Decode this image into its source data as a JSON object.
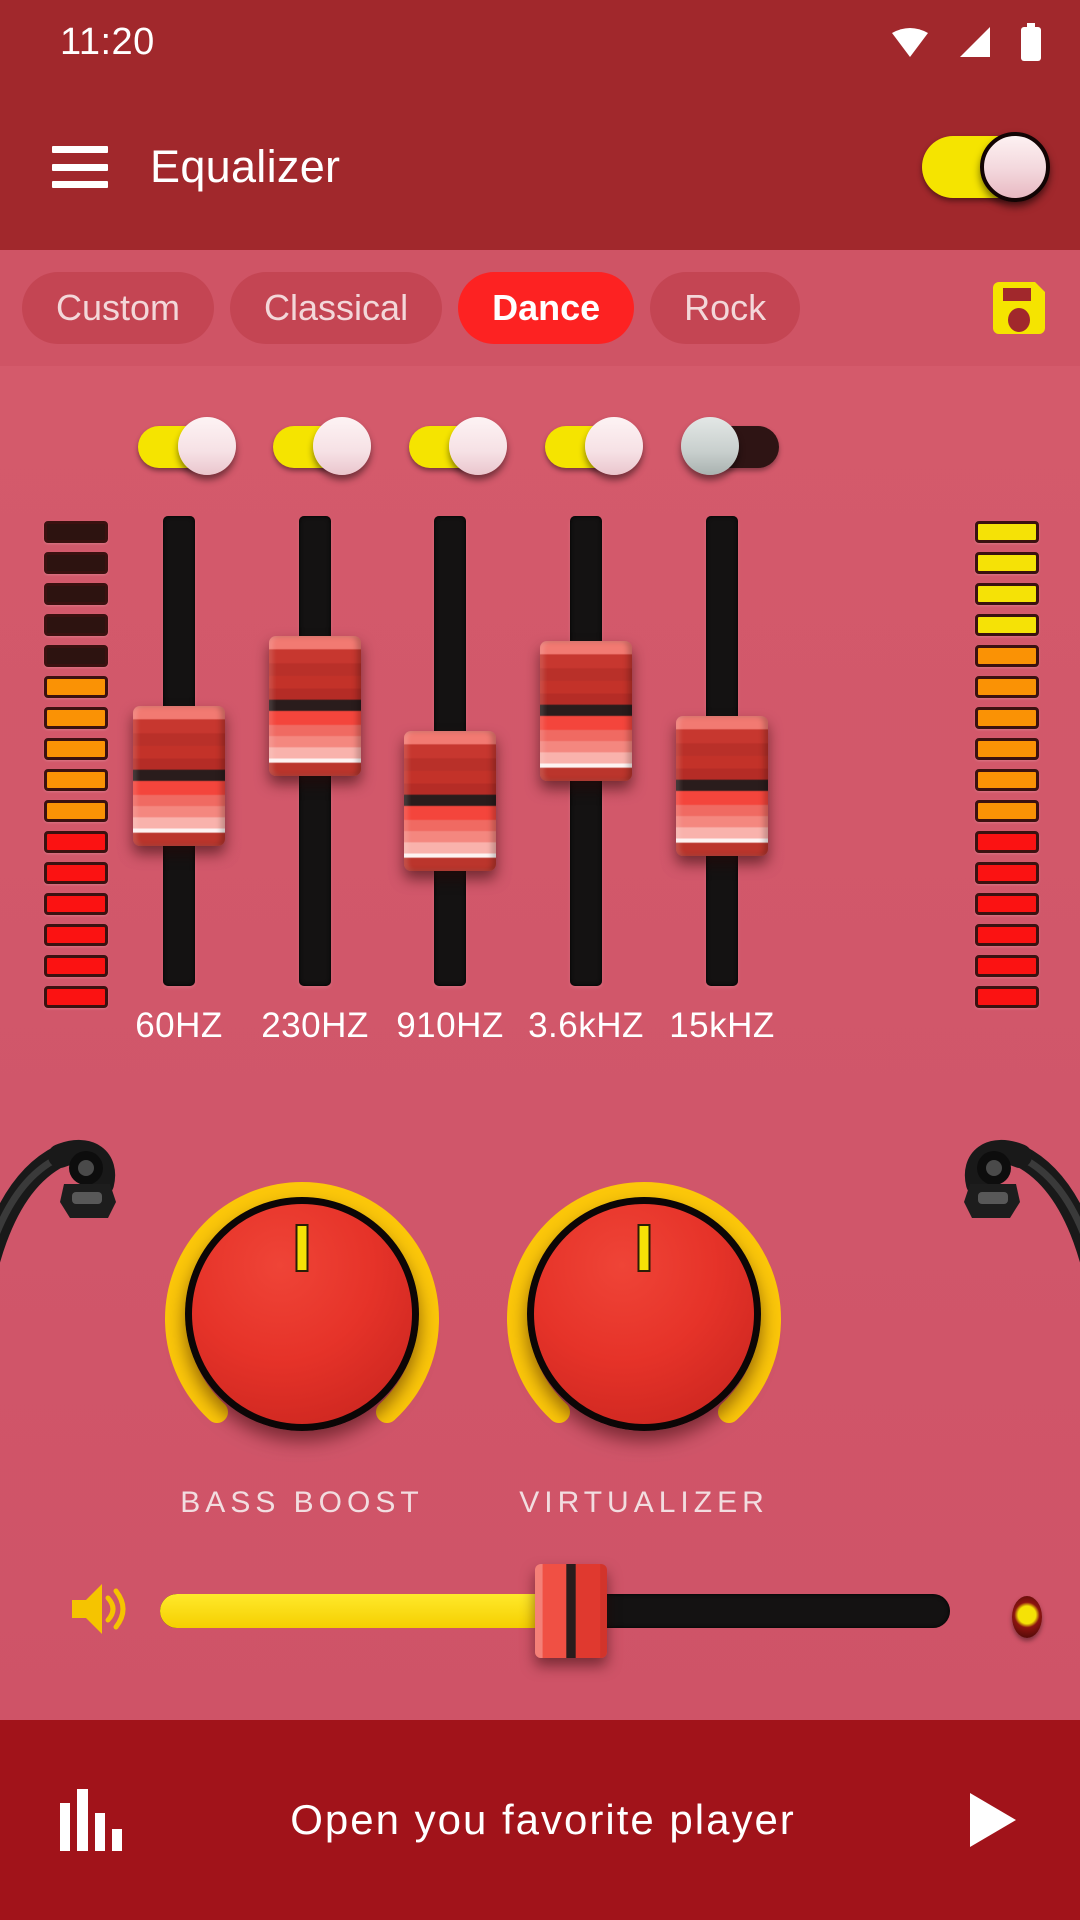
{
  "status_bar": {
    "time": "11:20",
    "icons": [
      "wifi-icon",
      "signal-icon",
      "battery-icon"
    ]
  },
  "app_bar": {
    "menu_icon": "hamburger-menu-icon",
    "title": "Equalizer",
    "master_switch": {
      "state": "on",
      "track_color": "#f5e400"
    }
  },
  "presets": {
    "items": [
      {
        "label": "Custom",
        "active": false
      },
      {
        "label": "Classical",
        "active": false
      },
      {
        "label": "Dance",
        "active": true
      },
      {
        "label": "Rock",
        "active": false
      }
    ],
    "save_icon": "floppy-save-icon",
    "active_color": "#fd2222",
    "save_color": "#f5e400"
  },
  "equalizer": {
    "bands": [
      {
        "label": "60HZ",
        "toggle": "on",
        "value": 44
      },
      {
        "label": "230HZ",
        "toggle": "on",
        "value": 63
      },
      {
        "label": "910HZ",
        "toggle": "on",
        "value": 36
      },
      {
        "label": "3.6kHZ",
        "toggle": "on",
        "value": 62
      },
      {
        "label": "15kHZ",
        "toggle": "off",
        "value": 41
      }
    ],
    "meter_left": [
      "off",
      "off",
      "off",
      "off",
      "off",
      "o",
      "o",
      "o",
      "o",
      "o",
      "r",
      "r",
      "r",
      "r",
      "r",
      "r"
    ],
    "meter_right": [
      "y",
      "y",
      "y",
      "y",
      "o",
      "o",
      "o",
      "o",
      "o",
      "o",
      "r",
      "r",
      "r",
      "r",
      "r",
      "r"
    ]
  },
  "knobs": [
    {
      "label": "BASS BOOST",
      "value": 0
    },
    {
      "label": "VIRTUALIZER",
      "value": 0
    }
  ],
  "volume": {
    "speaker_icon": "volume-speaker-icon",
    "level": 52,
    "led": "indicator-led"
  },
  "bottom_bar": {
    "eq_icon": "equalizer-bars-icon",
    "text": "Open you favorite player",
    "play_icon": "play-triangle-icon"
  },
  "colors": {
    "header": "#a1282c",
    "panel": "#d45a6b",
    "preset_bar": "#cf5465",
    "bottom_bar": "#a1131a",
    "accent_yellow": "#f5e400",
    "accent_red": "#fd2222"
  }
}
